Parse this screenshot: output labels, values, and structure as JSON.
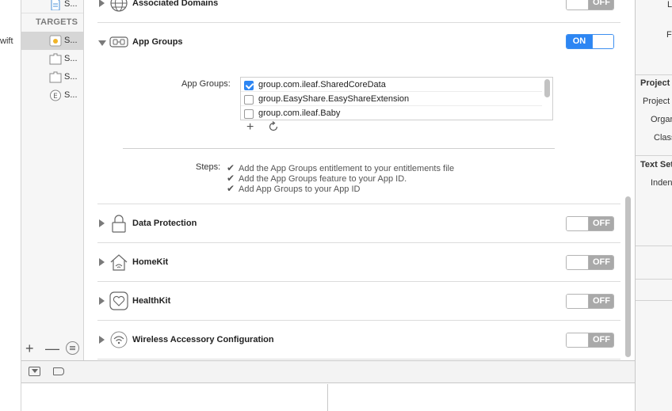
{
  "left_gutter": {
    "fragment": "wift"
  },
  "sidebar": {
    "top_item_label": "S...",
    "targets_header": "TARGETS",
    "targets": [
      {
        "label": "S...",
        "icon": "app-target-icon",
        "selected": true
      },
      {
        "label": "S...",
        "icon": "extension-target-icon",
        "selected": false
      },
      {
        "label": "S...",
        "icon": "extension-target-icon",
        "selected": false
      },
      {
        "label": "S...",
        "icon": "e-target-icon",
        "selected": false
      }
    ],
    "add_label": "+",
    "remove_label": "—"
  },
  "capabilities": {
    "associated_domains": {
      "title": "Associated Domains",
      "state": "OFF"
    },
    "app_groups": {
      "title": "App Groups",
      "state": "ON",
      "list_label": "App Groups:",
      "groups": [
        {
          "name": "group.com.ileaf.SharedCoreData",
          "checked": true
        },
        {
          "name": "group.EasyShare.EasyShareExtension",
          "checked": false
        },
        {
          "name": "group.com.ileaf.Baby",
          "checked": false
        }
      ],
      "add_label": "+",
      "steps_label": "Steps:",
      "steps": [
        "Add the App Groups entitlement to your entitlements file",
        "Add the App Groups feature to your App ID.",
        "Add App Groups to your App ID"
      ]
    },
    "data_protection": {
      "title": "Data Protection",
      "state": "OFF"
    },
    "homekit": {
      "title": "HomeKit",
      "state": "OFF"
    },
    "healthkit": {
      "title": "HealthKit",
      "state": "OFF"
    },
    "wireless_accessory": {
      "title": "Wireless Accessory Configuration",
      "state": "OFF"
    }
  },
  "inspector": {
    "frag1": "Lo",
    "frag2": "Fu",
    "project_header": "Project D",
    "project_label": "Project",
    "organization_label": "Organi",
    "class_label": "Class",
    "text_settings_header": "Text Sett",
    "indent_label": "Indent"
  },
  "colors": {
    "accent": "#2d86f3",
    "toggle_off": "#a9a9a9",
    "sidebar_selected": "#d6d6d6"
  }
}
